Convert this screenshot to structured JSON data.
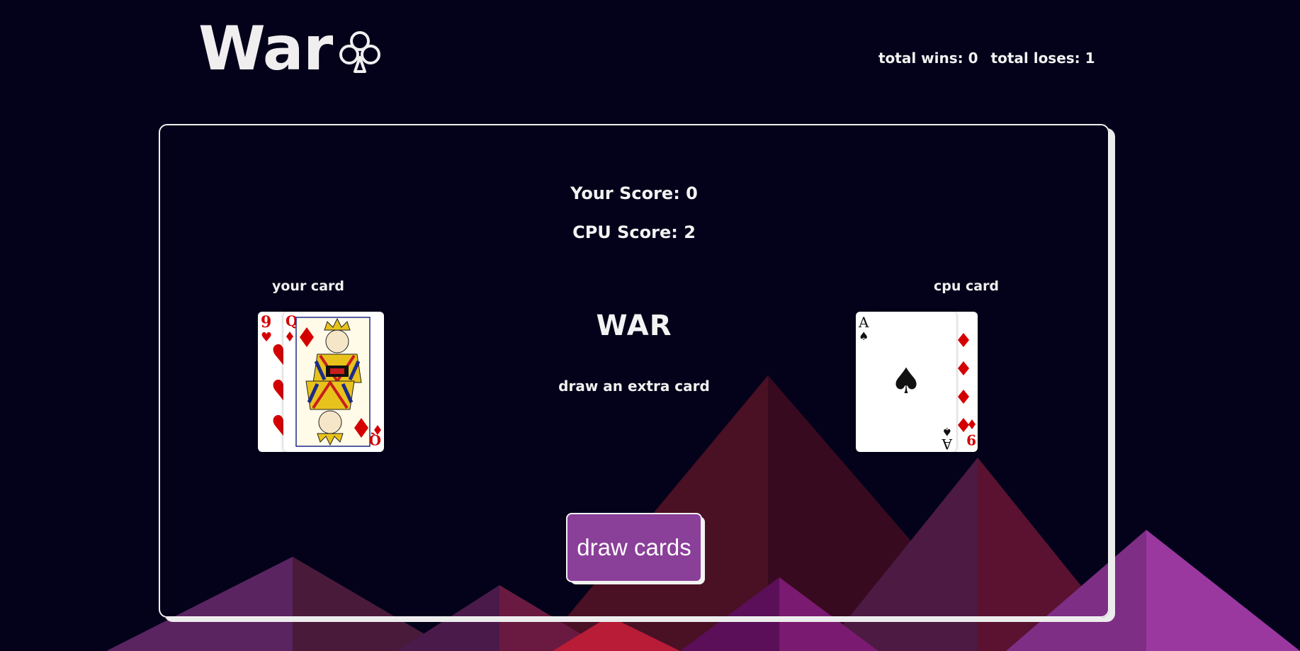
{
  "header": {
    "logo_text": "War",
    "logo_icon": "club-outline-icon",
    "total_wins_label": "total wins: 0",
    "total_loses_label": "total loses: 1"
  },
  "board": {
    "your_score": "Your Score: 0",
    "cpu_score": "CPU Score: 2",
    "your_card_label": "your card",
    "cpu_card_label": "cpu card",
    "result_title": "WAR",
    "result_message": "draw an extra card"
  },
  "cards": {
    "player_back": {
      "rank": "9",
      "suit": "hearts"
    },
    "player_front": {
      "rank": "Q",
      "suit": "diamonds"
    },
    "cpu_front": {
      "rank": "A",
      "suit": "spades"
    },
    "cpu_back": {
      "rank": "9",
      "suit": "diamonds"
    }
  },
  "controls": {
    "draw_button_label": "draw cards"
  },
  "colors": {
    "background": "#03021a",
    "button": "#8a3f99",
    "card_red": "#d40000",
    "text": "#f2f2f2"
  }
}
